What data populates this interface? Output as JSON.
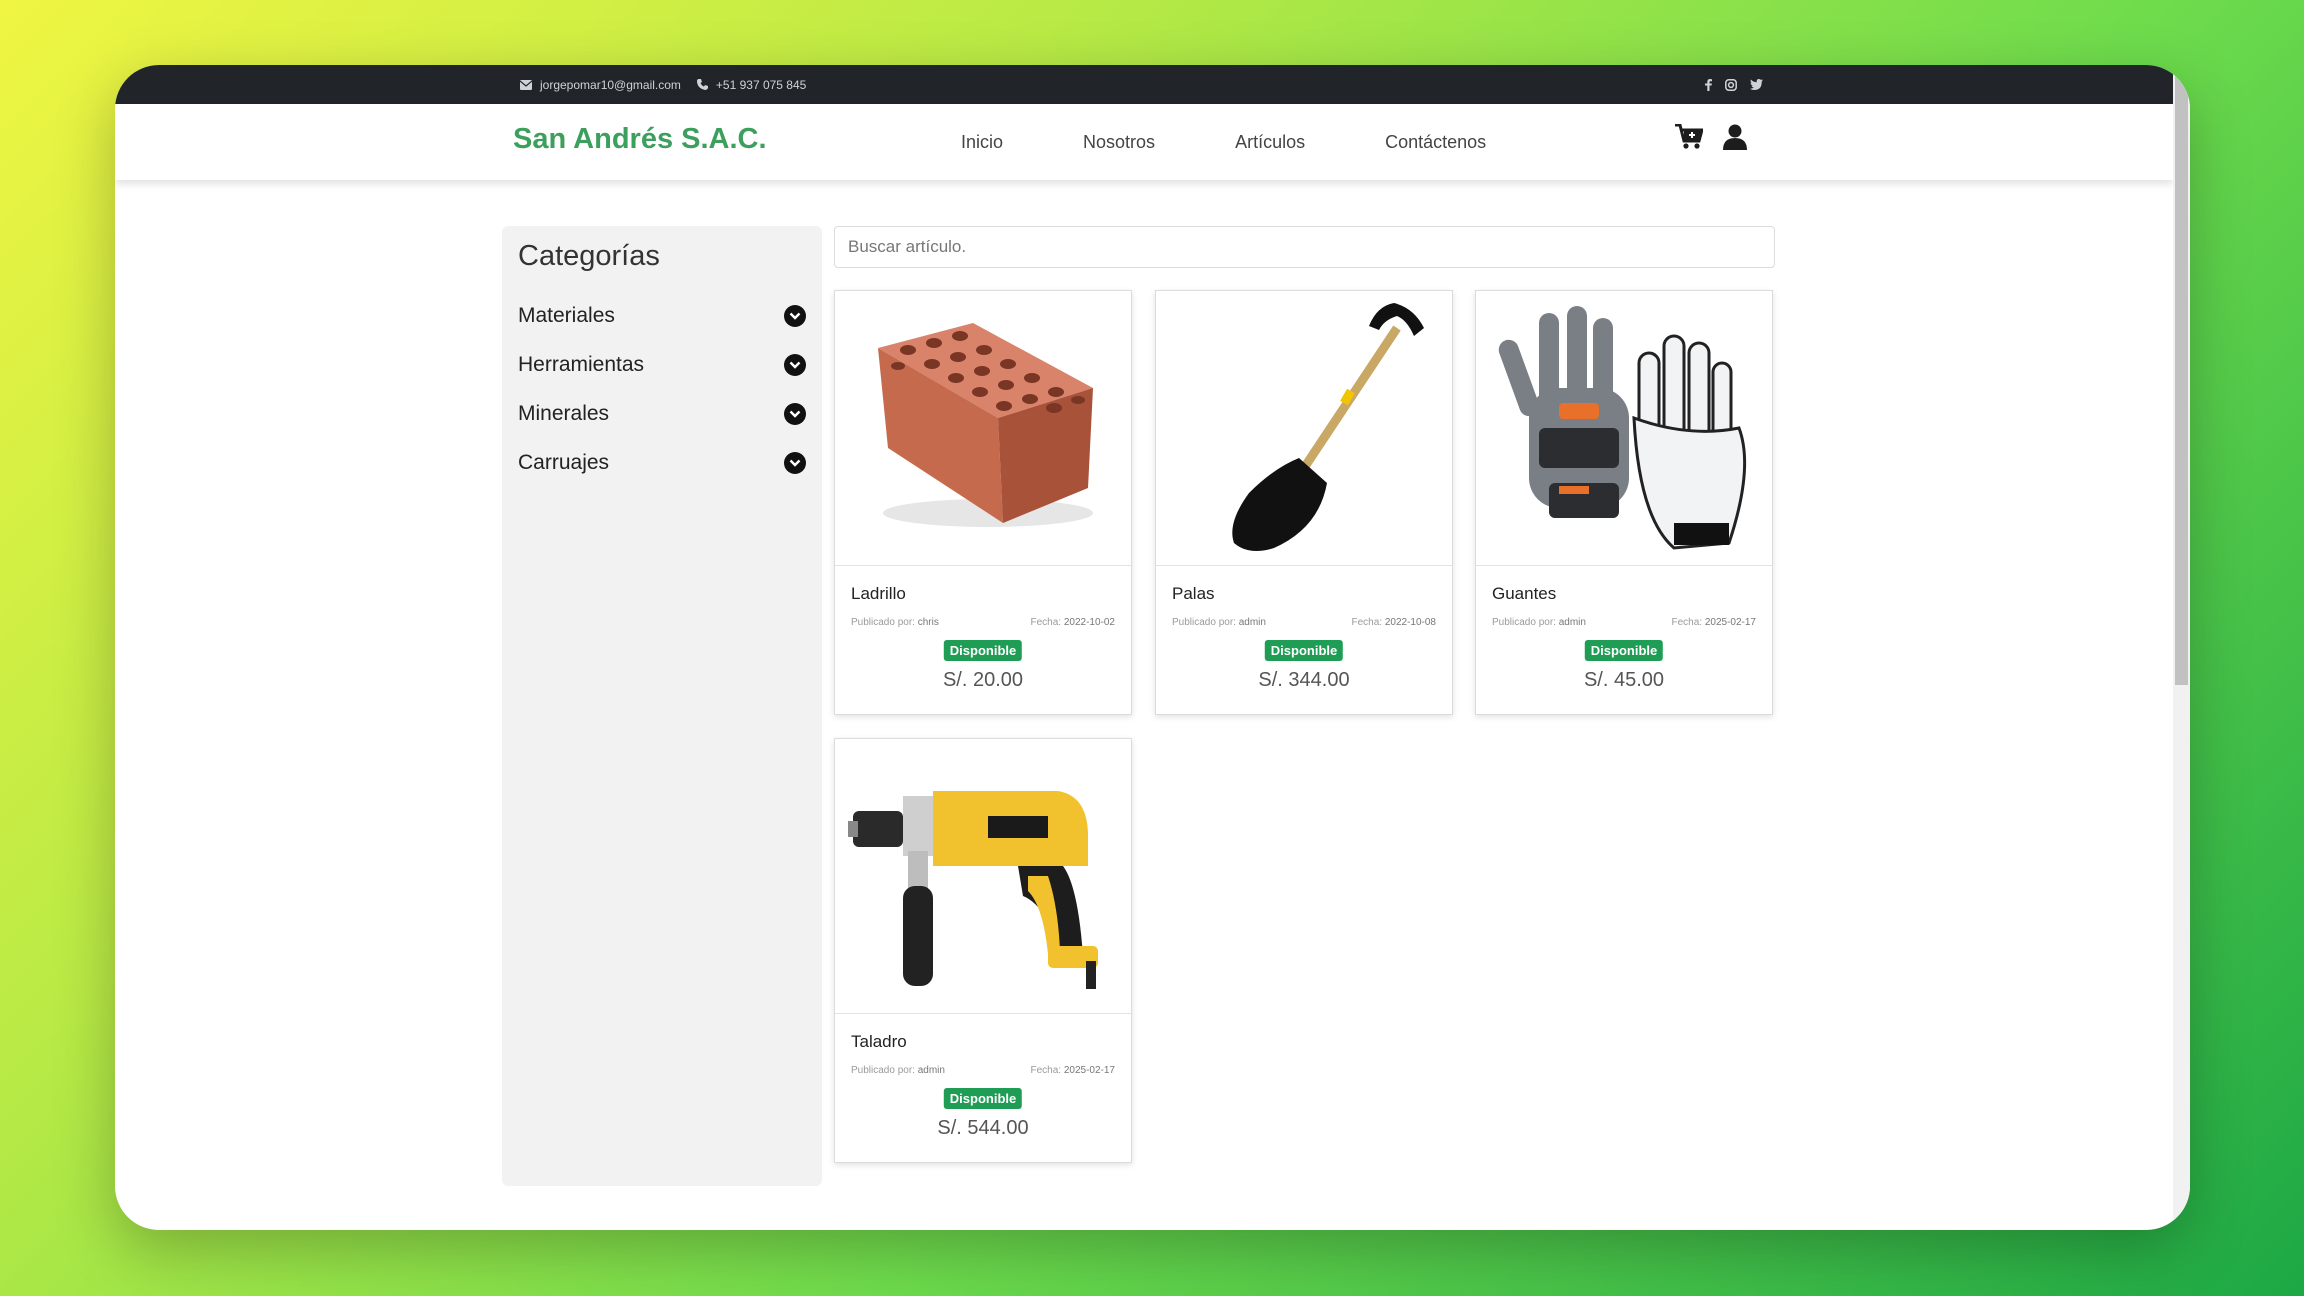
{
  "topbar": {
    "email": "jorgepomar10@gmail.com",
    "phone": "+51 937 075 845",
    "social": [
      "facebook-icon",
      "instagram-icon",
      "twitter-icon"
    ]
  },
  "navbar": {
    "brand": "San Andrés S.A.C.",
    "links": [
      "Inicio",
      "Nosotros",
      "Artículos",
      "Contáctenos"
    ],
    "icons": [
      "cart-icon",
      "user-icon"
    ]
  },
  "sidebar": {
    "title": "Categorías",
    "categories": [
      "Materiales",
      "Herramientas",
      "Minerales",
      "Carruajes"
    ]
  },
  "search": {
    "placeholder": "Buscar artículo."
  },
  "products": [
    {
      "name": "Ladrillo",
      "published_label": "Publicado por:",
      "author": "chris",
      "date_label": "Fecha:",
      "date": "2022-10-02",
      "status": "Disponible",
      "price": "S/. 20.00",
      "image": "brick"
    },
    {
      "name": "Palas",
      "published_label": "Publicado por:",
      "author": "admin",
      "date_label": "Fecha:",
      "date": "2022-10-08",
      "status": "Disponible",
      "price": "S/. 344.00",
      "image": "shovel"
    },
    {
      "name": "Guantes",
      "published_label": "Publicado por:",
      "author": "admin",
      "date_label": "Fecha:",
      "date": "2025-02-17",
      "status": "Disponible",
      "price": "S/. 45.00",
      "image": "gloves"
    },
    {
      "name": "Taladro",
      "published_label": "Publicado por:",
      "author": "admin",
      "date_label": "Fecha:",
      "date": "2025-02-17",
      "status": "Disponible",
      "price": "S/. 544.00",
      "image": "drill"
    }
  ],
  "colors": {
    "brand": "#3d9f5d",
    "topbar": "#212529",
    "badge": "#1f9d55"
  }
}
